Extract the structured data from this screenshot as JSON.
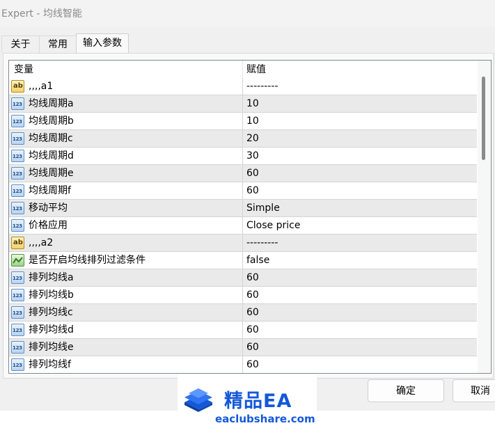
{
  "window": {
    "title": "Expert - 均线智能"
  },
  "tabs": [
    {
      "label": "关于"
    },
    {
      "label": "常用"
    },
    {
      "label": "输入参数"
    }
  ],
  "grid": {
    "header": {
      "variable": "变量",
      "value": "赋值"
    },
    "rows": [
      {
        "icon": "string-type-icon",
        "icon_text": "ab",
        "name": ",,,,a1",
        "value": "---------"
      },
      {
        "icon": "number-type-icon",
        "icon_text": "123",
        "name": "均线周期a",
        "value": "10"
      },
      {
        "icon": "number-type-icon",
        "icon_text": "123",
        "name": "均线周期b",
        "value": "10"
      },
      {
        "icon": "number-type-icon",
        "icon_text": "123",
        "name": "均线周期c",
        "value": "20"
      },
      {
        "icon": "number-type-icon",
        "icon_text": "123",
        "name": "均线周期d",
        "value": "30"
      },
      {
        "icon": "number-type-icon",
        "icon_text": "123",
        "name": "均线周期e",
        "value": "60"
      },
      {
        "icon": "number-type-icon",
        "icon_text": "123",
        "name": "均线周期f",
        "value": "60"
      },
      {
        "icon": "number-type-icon",
        "icon_text": "123",
        "name": "移动平均",
        "value": "Simple"
      },
      {
        "icon": "number-type-icon",
        "icon_text": "123",
        "name": "价格应用",
        "value": "Close price"
      },
      {
        "icon": "string-type-icon",
        "icon_text": "ab",
        "name": ",,,,a2",
        "value": "---------"
      },
      {
        "icon": "boolean-type-icon",
        "icon_text": "",
        "name": "是否开启均线排列过滤条件",
        "value": "false"
      },
      {
        "icon": "number-type-icon",
        "icon_text": "123",
        "name": "排列均线a",
        "value": "60"
      },
      {
        "icon": "number-type-icon",
        "icon_text": "123",
        "name": "排列均线b",
        "value": "60"
      },
      {
        "icon": "number-type-icon",
        "icon_text": "123",
        "name": "排列均线c",
        "value": "60"
      },
      {
        "icon": "number-type-icon",
        "icon_text": "123",
        "name": "排列均线d",
        "value": "60"
      },
      {
        "icon": "number-type-icon",
        "icon_text": "123",
        "name": "排列均线e",
        "value": "60"
      },
      {
        "icon": "number-type-icon",
        "icon_text": "123",
        "name": "排列均线f",
        "value": "60"
      }
    ]
  },
  "buttons": {
    "ok": "确定",
    "cancel": "取消"
  },
  "watermark": {
    "title": "精品EA",
    "url": "eaclubshare.com"
  },
  "colors": {
    "accent": "#1458d8",
    "row_alt": "#eaeaea"
  }
}
